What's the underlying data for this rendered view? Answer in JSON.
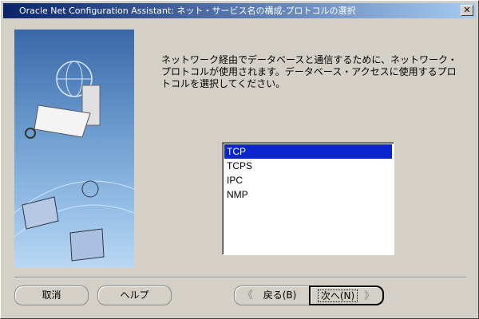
{
  "window": {
    "title": "Oracle Net Configuration Assistant: ネット・サービス名の構成-プロトコルの選択",
    "close_label": "✕"
  },
  "description": "ネットワーク経由でデータベースと通信するために、ネットワーク・プロトコルが使用されます。データベース・アクセスに使用するプロトコルを選択してください。",
  "protocols": {
    "items": [
      "TCP",
      "TCPS",
      "IPC",
      "NMP"
    ],
    "selected": "TCP"
  },
  "buttons": {
    "cancel": "取消",
    "help": "ヘルプ",
    "back": "戻る(B)",
    "next": "次へ(N)",
    "back_arrow": "《",
    "next_arrow": "》"
  }
}
